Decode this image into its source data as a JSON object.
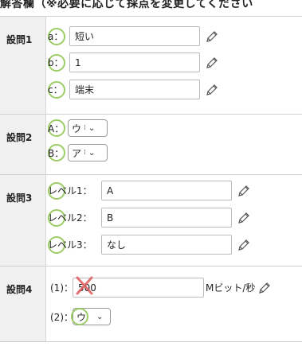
{
  "header": {
    "title": "解答欄（※必要に応じて採点を変更してください"
  },
  "q1": {
    "label": "設問1",
    "rows": [
      {
        "prefix": "a：",
        "value": "短い"
      },
      {
        "prefix": "b：",
        "value": "1"
      },
      {
        "prefix": "c：",
        "value": "端末"
      }
    ]
  },
  "q2": {
    "label": "設問2",
    "rows": [
      {
        "prefix": "A：",
        "selected": "ウ"
      },
      {
        "prefix": "B：",
        "selected": "ア"
      }
    ]
  },
  "q3": {
    "label": "設問3",
    "rows": [
      {
        "prefix": "レベル1：",
        "value": "A"
      },
      {
        "prefix": "レベル2：",
        "value": "B"
      },
      {
        "prefix": "レベル3：",
        "value": "なし"
      }
    ]
  },
  "q4": {
    "label": "設問4",
    "row1": {
      "prefix": "(1)：",
      "value": "500",
      "unit": "Mビット/秒"
    },
    "row2": {
      "prefix": "(2)：",
      "selected": "ウ"
    }
  },
  "icons": {
    "edit": "pencil-icon",
    "correct": "green-circle-mark",
    "incorrect": "red-x-mark"
  },
  "colors": {
    "correct": "#9ccc65",
    "incorrect": "#e05a5a",
    "label_bg": "#f0f0f0"
  }
}
